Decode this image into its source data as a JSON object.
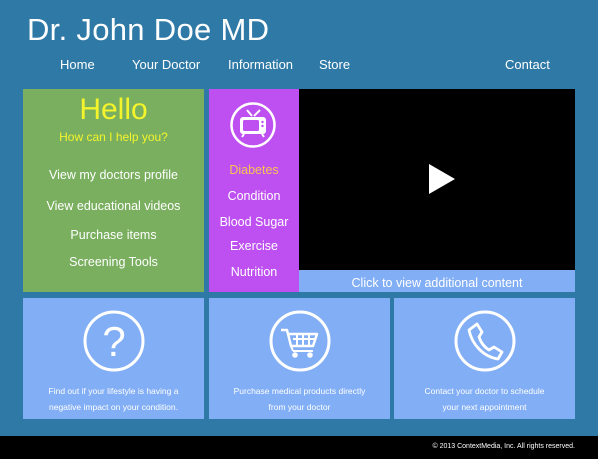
{
  "header": {
    "title": "Dr. John Doe MD",
    "nav": [
      "Home",
      "Your Doctor",
      "Information",
      "Store",
      "Contact"
    ]
  },
  "welcome": {
    "heading": "Hello",
    "subheading": "How can I help you?",
    "links": [
      "View my doctors profile",
      "View educational videos",
      "Purchase items",
      "Screening Tools"
    ]
  },
  "topics": {
    "icon": "tv-icon",
    "items": [
      "Diabetes",
      "Condition",
      "Blood Sugar",
      "Exercise",
      "Nutrition"
    ],
    "active_color": "#f5c552"
  },
  "video": {
    "icon": "play-icon",
    "caption": "Click to view additional content"
  },
  "cards": [
    {
      "icon": "question-mark-icon",
      "line1": "Find out if your lifestyle is having a",
      "line2": "negative impact on your condition."
    },
    {
      "icon": "shopping-cart-icon",
      "line1": "Purchase medical products directly",
      "line2": "from your doctor"
    },
    {
      "icon": "phone-icon",
      "line1": "Contact your doctor to schedule",
      "line2": "your next appointment"
    }
  ],
  "footer": {
    "copyright": "© 2013 ContextMedia, Inc. All rights reserved."
  },
  "colors": {
    "background": "#2f79a6",
    "green_panel": "#79af5e",
    "purple_panel": "#be4ff0",
    "light_blue": "#82aef5",
    "hello_yellow": "#f4f42c"
  }
}
